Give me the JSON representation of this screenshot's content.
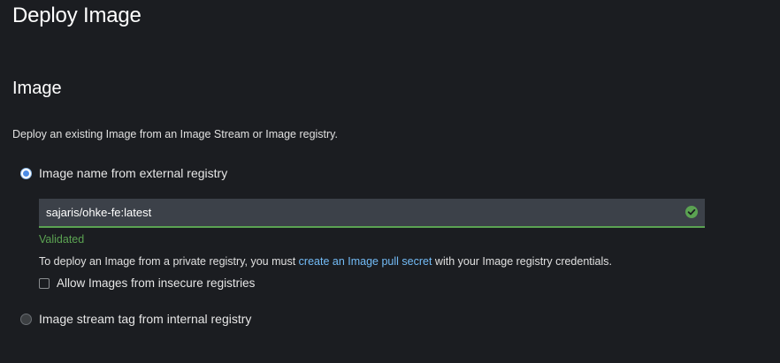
{
  "page": {
    "title": "Deploy Image"
  },
  "section": {
    "title": "Image",
    "description": "Deploy an existing Image from an Image Stream or Image registry."
  },
  "options": {
    "external": {
      "label": "Image name from external registry",
      "selected": true
    },
    "internal": {
      "label": "Image stream tag from internal registry",
      "selected": false
    }
  },
  "image_input": {
    "value": "sajaris/ohke-fe:latest",
    "status_icon": "check-circle-icon",
    "status_color": "#5ba352"
  },
  "validation": {
    "text": "Validated"
  },
  "helper": {
    "prefix": "To deploy an Image from a private registry, you must ",
    "link": "create an Image pull secret",
    "suffix": " with your Image registry credentials."
  },
  "insecure": {
    "label": "Allow Images from insecure registries",
    "checked": false
  },
  "colors": {
    "background": "#1b1d21",
    "link": "#73bcf7",
    "success": "#5ba352",
    "radio_selected": "#4c8ce6"
  }
}
